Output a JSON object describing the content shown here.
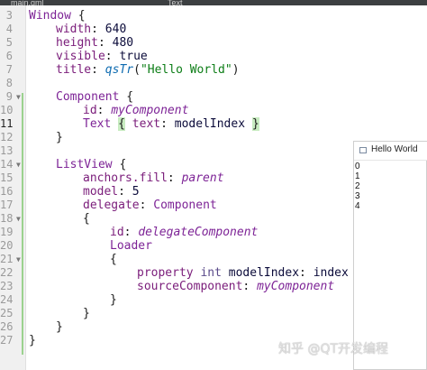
{
  "tabs": [
    "main.qml",
    "Text"
  ],
  "line_numbers": [
    "3",
    "4",
    "5",
    "6",
    "7",
    "8",
    "9",
    "10",
    "11",
    "12",
    "13",
    "14",
    "15",
    "16",
    "17",
    "18",
    "19",
    "20",
    "21",
    "22",
    "23",
    "24",
    "25",
    "26",
    "27"
  ],
  "code": {
    "l3": {
      "type": "Window",
      "brace": " {"
    },
    "l4": {
      "prop": "width",
      "colon": ": ",
      "val": "640"
    },
    "l5": {
      "prop": "height",
      "colon": ": ",
      "val": "480"
    },
    "l6": {
      "prop": "visible",
      "colon": ": ",
      "val": "true"
    },
    "l7": {
      "prop": "title",
      "colon": ": ",
      "fn": "qsTr",
      "open": "(",
      "str": "\"Hello World\"",
      "close": ")"
    },
    "l9": {
      "type": "Component",
      "brace": " {"
    },
    "l10": {
      "prop": "id",
      "colon": ": ",
      "val": "myComponent"
    },
    "l11": {
      "type": "Text",
      "open_brace": "{",
      "prop": " text",
      "colon": ": ",
      "val": "modelIndex ",
      "close_brace": "}"
    },
    "l12": {
      "brace": "}"
    },
    "l14": {
      "type": "ListView",
      "brace": " {"
    },
    "l15": {
      "prop": "anchors.fill",
      "colon": ": ",
      "val": "parent"
    },
    "l16": {
      "prop": "model",
      "colon": ": ",
      "val": "5"
    },
    "l17": {
      "prop": "delegate",
      "colon": ": ",
      "type": "Component"
    },
    "l18": {
      "brace": "{"
    },
    "l19": {
      "prop": "id",
      "colon": ": ",
      "val": "delegateComponent"
    },
    "l20": {
      "type": "Loader"
    },
    "l21": {
      "brace": "{"
    },
    "l22": {
      "kw": "property ",
      "kwtype": "int ",
      "prop": "modelIndex",
      "colon": ": ",
      "val": "index"
    },
    "l23": {
      "prop": "sourceComponent",
      "colon": ": ",
      "val": "myComponent"
    },
    "l24": {
      "brace": "}"
    },
    "l25": {
      "brace": "}"
    },
    "l26": {
      "brace": "}"
    },
    "l27": {
      "brace": "}"
    }
  },
  "preview": {
    "title": "Hello World",
    "items": [
      "0",
      "1",
      "2",
      "3",
      "4"
    ]
  },
  "watermark": "知乎 @QT开发编程"
}
